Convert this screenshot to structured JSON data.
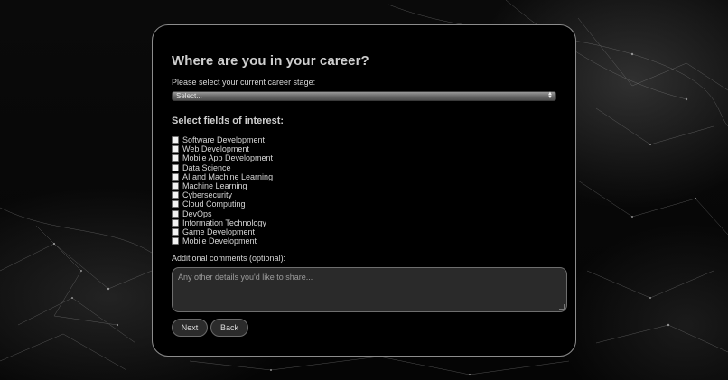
{
  "form": {
    "title": "Where are you in your career?",
    "stage_label": "Please select your current career stage:",
    "stage_select": {
      "selected": "Select..."
    },
    "fields_title": "Select fields of interest:",
    "fields": [
      {
        "label": "Software Development",
        "checked": false
      },
      {
        "label": "Web Development",
        "checked": false
      },
      {
        "label": "Mobile App Development",
        "checked": false
      },
      {
        "label": "Data Science",
        "checked": false
      },
      {
        "label": "AI and Machine Learning",
        "checked": false
      },
      {
        "label": "Machine Learning",
        "checked": false
      },
      {
        "label": "Cybersecurity",
        "checked": false
      },
      {
        "label": "Cloud Computing",
        "checked": false
      },
      {
        "label": "DevOps",
        "checked": false
      },
      {
        "label": "Information Technology",
        "checked": false
      },
      {
        "label": "Game Development",
        "checked": false
      },
      {
        "label": "Mobile Development",
        "checked": false
      }
    ],
    "comments_label": "Additional comments (optional):",
    "comments_placeholder": "Any other details you'd like to share...",
    "next_label": "Next",
    "back_label": "Back"
  },
  "colors": {
    "card_background": "#000000",
    "card_border": "#8c8c8c",
    "text": "#d6d6d6",
    "button_background": "#2b2b2b"
  }
}
